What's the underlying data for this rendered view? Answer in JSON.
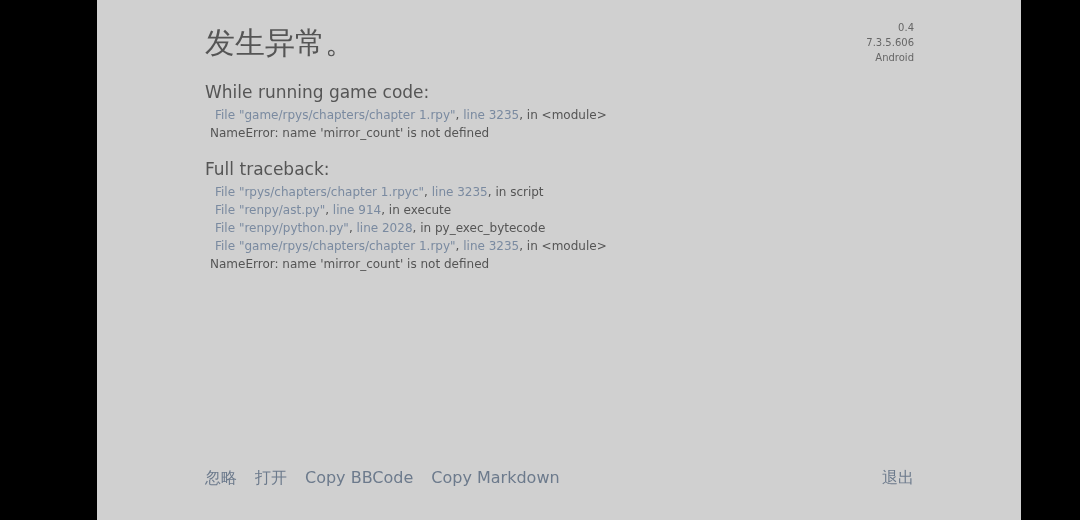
{
  "title": "发生异常。",
  "version_info": [
    "0.4",
    "7.3.5.606",
    "Android"
  ],
  "sections": [
    {
      "heading": "While running game code:",
      "frames": [
        {
          "file": "File \"game/rpys/chapters/chapter 1.rpy\"",
          "sep": ", ",
          "line": "line 3235",
          "rest": ", in <module>"
        }
      ],
      "error": "NameError: name 'mirror_count' is not defined"
    },
    {
      "heading": "Full traceback:",
      "frames": [
        {
          "file": "File \"rpys/chapters/chapter 1.rpyc\"",
          "sep": ", ",
          "line": "line 3235",
          "rest": ", in script"
        },
        {
          "file": "File \"renpy/ast.py\"",
          "sep": ", ",
          "line": "line 914",
          "rest": ", in execute"
        },
        {
          "file": "File \"renpy/python.py\"",
          "sep": ", ",
          "line": "line 2028",
          "rest": ", in py_exec_bytecode"
        },
        {
          "file": "File \"game/rpys/chapters/chapter 1.rpy\"",
          "sep": ", ",
          "line": "line 3235",
          "rest": ", in <module>"
        }
      ],
      "error": "NameError: name 'mirror_count' is not defined"
    }
  ],
  "actions": [
    "忽略",
    "打开",
    "Copy BBCode",
    "Copy Markdown"
  ],
  "quit": "退出"
}
